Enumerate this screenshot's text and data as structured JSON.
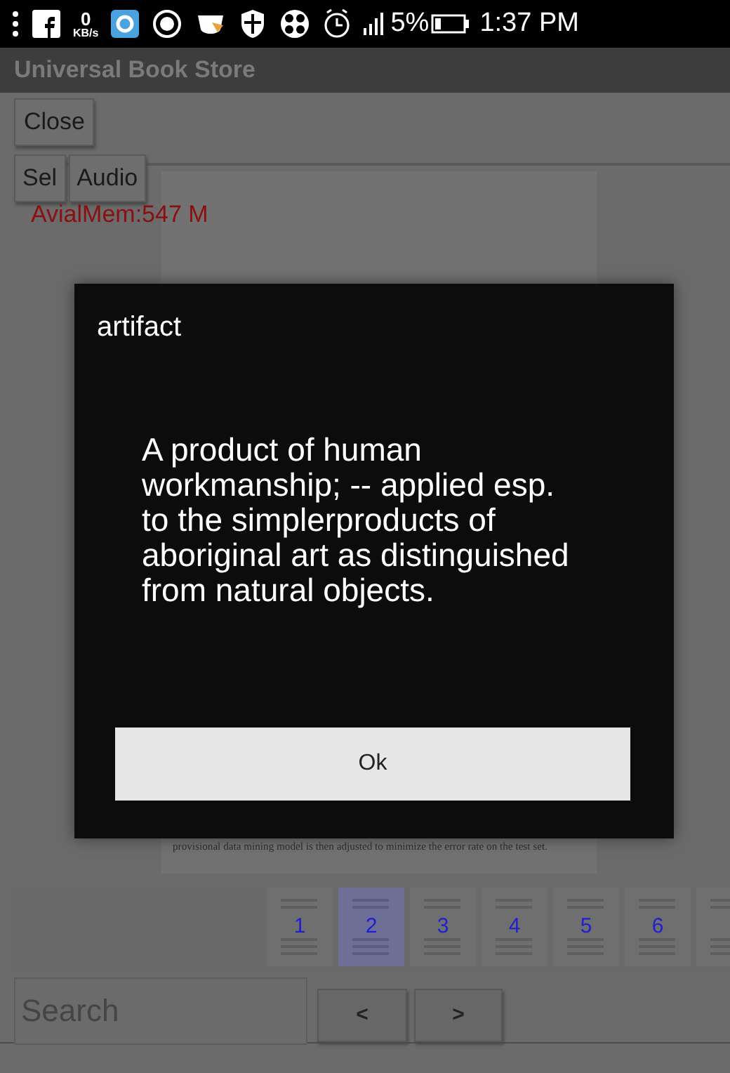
{
  "status_bar": {
    "network_speed": "0",
    "network_unit": "KB/s",
    "battery": "5%",
    "time": "1:37 PM"
  },
  "app_bar": {
    "title": "Universal Book Store"
  },
  "toolbar": {
    "close_button": "Close",
    "buttons": [
      "Sel",
      "Audio"
    ],
    "memory": "AvialMem:547 M"
  },
  "document": {
    "visible_text": "provisional data mining model is then adjusted to minimize the error rate on the test set."
  },
  "thumbnails": [
    {
      "label": "1",
      "selected": false
    },
    {
      "label": "2",
      "selected": true
    },
    {
      "label": "3",
      "selected": false
    },
    {
      "label": "4",
      "selected": false
    },
    {
      "label": "5",
      "selected": false
    },
    {
      "label": "6",
      "selected": false
    },
    {
      "selected": false
    }
  ],
  "search": {
    "placeholder": "Search",
    "prev": "<",
    "next": ">"
  },
  "dialog": {
    "title": "artifact",
    "message": "A product of human workmanship; -- applied esp. to the simplerproducts of aboriginal art as distinguished from natural objects.",
    "button": "Ok"
  }
}
